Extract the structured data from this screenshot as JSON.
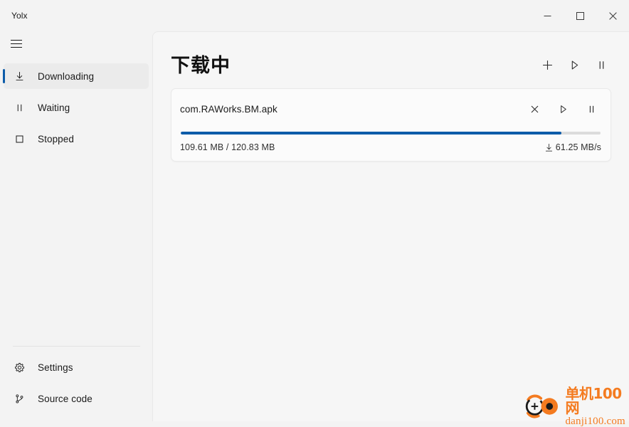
{
  "window": {
    "title": "Yolx",
    "controls": {
      "minimize": "minimize-button",
      "maximize": "maximize-button",
      "close": "close-button"
    }
  },
  "sidebar": {
    "menu_icon": "hamburger-icon",
    "items": [
      {
        "label": "Downloading",
        "icon": "download-icon",
        "selected": true
      },
      {
        "label": "Waiting",
        "icon": "pause-icon",
        "selected": false
      },
      {
        "label": "Stopped",
        "icon": "stop-square-icon",
        "selected": false
      }
    ],
    "bottom_items": [
      {
        "label": "Settings",
        "icon": "gear-icon"
      },
      {
        "label": "Source code",
        "icon": "git-branch-icon"
      }
    ]
  },
  "main": {
    "title": "下载中",
    "header_actions": [
      {
        "name": "add-task-button",
        "icon": "plus-icon"
      },
      {
        "name": "start-all-button",
        "icon": "play-icon"
      },
      {
        "name": "pause-all-button",
        "icon": "pause-icon"
      }
    ],
    "download": {
      "filename": "com.RAWorks.BM.apk",
      "size_text": "109.61 MB / 120.83 MB",
      "downloaded": "109.61 MB",
      "total": "120.83 MB",
      "speed": "61.25 MB/s",
      "speed_icon": "download-arrow-icon",
      "progress_percent": 90.7,
      "actions": [
        {
          "name": "remove-task-button",
          "icon": "close-icon"
        },
        {
          "name": "resume-task-button",
          "icon": "play-icon"
        },
        {
          "name": "pause-task-button",
          "icon": "pause-icon"
        }
      ]
    }
  },
  "annotation": {
    "type": "arrow",
    "color": "#ee1111",
    "points_to": "download-speed"
  },
  "watermark": {
    "cn_text": "单机100网",
    "en_text": "danji100.com",
    "color": "#f47b20",
    "logo_icon": "danji100-logo-icon"
  },
  "colors": {
    "accent": "#0d5ca9",
    "progress_track": "#dcdcdc",
    "sidebar_bg": "#f3f3f3",
    "content_bg": "#f6f6f6",
    "card_bg": "#fbfbfb"
  }
}
